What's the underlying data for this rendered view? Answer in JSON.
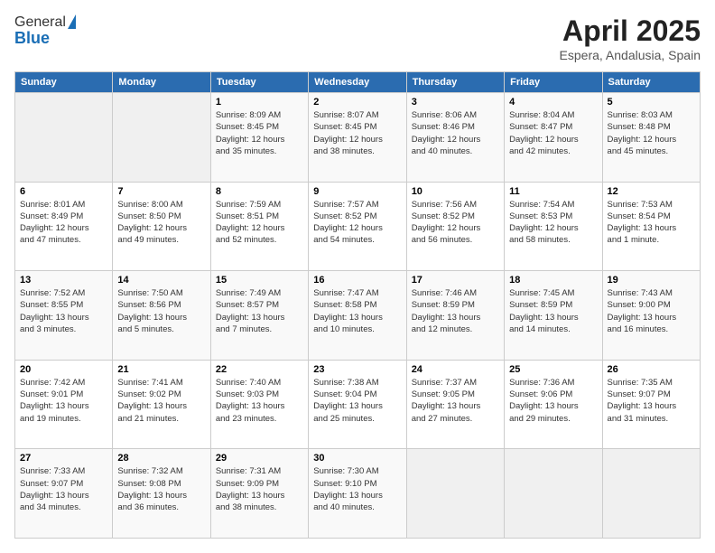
{
  "logo": {
    "line1": "General",
    "line2": "Blue"
  },
  "header": {
    "title": "April 2025",
    "subtitle": "Espera, Andalusia, Spain"
  },
  "weekdays": [
    "Sunday",
    "Monday",
    "Tuesday",
    "Wednesday",
    "Thursday",
    "Friday",
    "Saturday"
  ],
  "weeks": [
    [
      {
        "day": "",
        "info": ""
      },
      {
        "day": "",
        "info": ""
      },
      {
        "day": "1",
        "info": "Sunrise: 8:09 AM\nSunset: 8:45 PM\nDaylight: 12 hours\nand 35 minutes."
      },
      {
        "day": "2",
        "info": "Sunrise: 8:07 AM\nSunset: 8:45 PM\nDaylight: 12 hours\nand 38 minutes."
      },
      {
        "day": "3",
        "info": "Sunrise: 8:06 AM\nSunset: 8:46 PM\nDaylight: 12 hours\nand 40 minutes."
      },
      {
        "day": "4",
        "info": "Sunrise: 8:04 AM\nSunset: 8:47 PM\nDaylight: 12 hours\nand 42 minutes."
      },
      {
        "day": "5",
        "info": "Sunrise: 8:03 AM\nSunset: 8:48 PM\nDaylight: 12 hours\nand 45 minutes."
      }
    ],
    [
      {
        "day": "6",
        "info": "Sunrise: 8:01 AM\nSunset: 8:49 PM\nDaylight: 12 hours\nand 47 minutes."
      },
      {
        "day": "7",
        "info": "Sunrise: 8:00 AM\nSunset: 8:50 PM\nDaylight: 12 hours\nand 49 minutes."
      },
      {
        "day": "8",
        "info": "Sunrise: 7:59 AM\nSunset: 8:51 PM\nDaylight: 12 hours\nand 52 minutes."
      },
      {
        "day": "9",
        "info": "Sunrise: 7:57 AM\nSunset: 8:52 PM\nDaylight: 12 hours\nand 54 minutes."
      },
      {
        "day": "10",
        "info": "Sunrise: 7:56 AM\nSunset: 8:52 PM\nDaylight: 12 hours\nand 56 minutes."
      },
      {
        "day": "11",
        "info": "Sunrise: 7:54 AM\nSunset: 8:53 PM\nDaylight: 12 hours\nand 58 minutes."
      },
      {
        "day": "12",
        "info": "Sunrise: 7:53 AM\nSunset: 8:54 PM\nDaylight: 13 hours\nand 1 minute."
      }
    ],
    [
      {
        "day": "13",
        "info": "Sunrise: 7:52 AM\nSunset: 8:55 PM\nDaylight: 13 hours\nand 3 minutes."
      },
      {
        "day": "14",
        "info": "Sunrise: 7:50 AM\nSunset: 8:56 PM\nDaylight: 13 hours\nand 5 minutes."
      },
      {
        "day": "15",
        "info": "Sunrise: 7:49 AM\nSunset: 8:57 PM\nDaylight: 13 hours\nand 7 minutes."
      },
      {
        "day": "16",
        "info": "Sunrise: 7:47 AM\nSunset: 8:58 PM\nDaylight: 13 hours\nand 10 minutes."
      },
      {
        "day": "17",
        "info": "Sunrise: 7:46 AM\nSunset: 8:59 PM\nDaylight: 13 hours\nand 12 minutes."
      },
      {
        "day": "18",
        "info": "Sunrise: 7:45 AM\nSunset: 8:59 PM\nDaylight: 13 hours\nand 14 minutes."
      },
      {
        "day": "19",
        "info": "Sunrise: 7:43 AM\nSunset: 9:00 PM\nDaylight: 13 hours\nand 16 minutes."
      }
    ],
    [
      {
        "day": "20",
        "info": "Sunrise: 7:42 AM\nSunset: 9:01 PM\nDaylight: 13 hours\nand 19 minutes."
      },
      {
        "day": "21",
        "info": "Sunrise: 7:41 AM\nSunset: 9:02 PM\nDaylight: 13 hours\nand 21 minutes."
      },
      {
        "day": "22",
        "info": "Sunrise: 7:40 AM\nSunset: 9:03 PM\nDaylight: 13 hours\nand 23 minutes."
      },
      {
        "day": "23",
        "info": "Sunrise: 7:38 AM\nSunset: 9:04 PM\nDaylight: 13 hours\nand 25 minutes."
      },
      {
        "day": "24",
        "info": "Sunrise: 7:37 AM\nSunset: 9:05 PM\nDaylight: 13 hours\nand 27 minutes."
      },
      {
        "day": "25",
        "info": "Sunrise: 7:36 AM\nSunset: 9:06 PM\nDaylight: 13 hours\nand 29 minutes."
      },
      {
        "day": "26",
        "info": "Sunrise: 7:35 AM\nSunset: 9:07 PM\nDaylight: 13 hours\nand 31 minutes."
      }
    ],
    [
      {
        "day": "27",
        "info": "Sunrise: 7:33 AM\nSunset: 9:07 PM\nDaylight: 13 hours\nand 34 minutes."
      },
      {
        "day": "28",
        "info": "Sunrise: 7:32 AM\nSunset: 9:08 PM\nDaylight: 13 hours\nand 36 minutes."
      },
      {
        "day": "29",
        "info": "Sunrise: 7:31 AM\nSunset: 9:09 PM\nDaylight: 13 hours\nand 38 minutes."
      },
      {
        "day": "30",
        "info": "Sunrise: 7:30 AM\nSunset: 9:10 PM\nDaylight: 13 hours\nand 40 minutes."
      },
      {
        "day": "",
        "info": ""
      },
      {
        "day": "",
        "info": ""
      },
      {
        "day": "",
        "info": ""
      }
    ]
  ]
}
